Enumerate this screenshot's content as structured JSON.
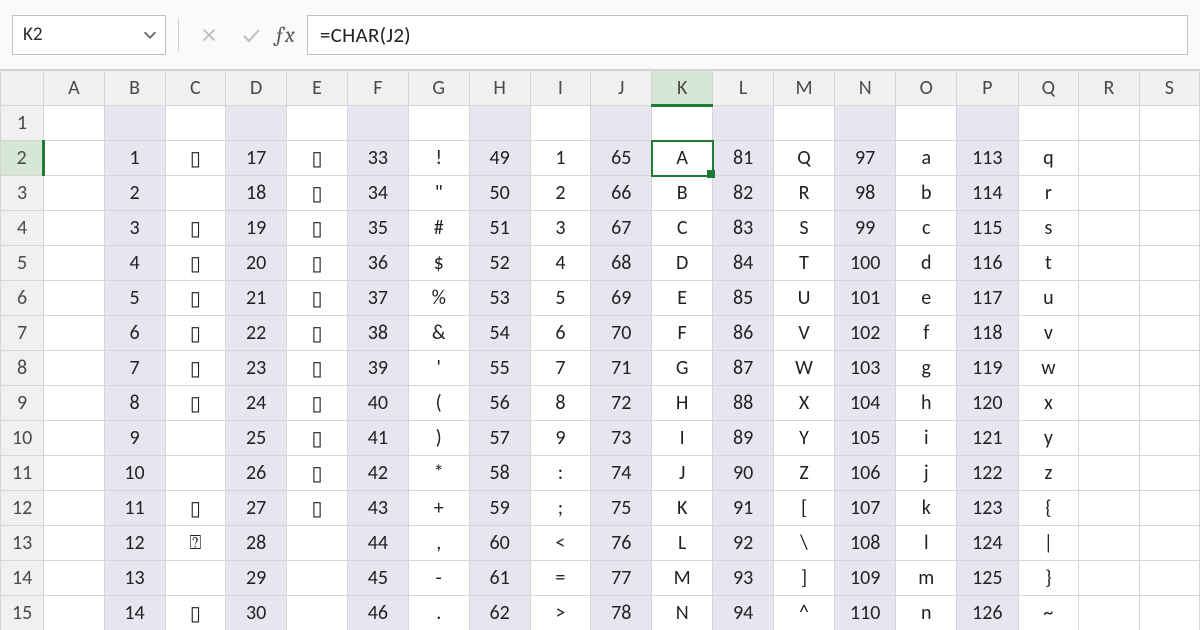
{
  "namebox": {
    "value": "K2"
  },
  "formula": {
    "text": "=CHAR(J2)"
  },
  "columns": [
    "A",
    "B",
    "C",
    "D",
    "E",
    "F",
    "G",
    "H",
    "I",
    "J",
    "K",
    "L",
    "M",
    "N",
    "O",
    "P",
    "Q",
    "R",
    "S"
  ],
  "row_numbers": [
    1,
    2,
    3,
    4,
    5,
    6,
    7,
    8,
    9,
    10,
    11,
    12,
    13,
    14,
    15
  ],
  "shaded_cols": [
    "B",
    "D",
    "F",
    "H",
    "J",
    "L",
    "N",
    "P"
  ],
  "active": {
    "col": "K",
    "row": 2
  },
  "rows": [
    {},
    {
      "B": "1",
      "C": "▯",
      "D": "17",
      "E": "▯",
      "F": "33",
      "G": "!",
      "H": "49",
      "I": "1",
      "J": "65",
      "K": "A",
      "L": "81",
      "M": "Q",
      "N": "97",
      "O": "a",
      "P": "113",
      "Q": "q"
    },
    {
      "B": "2",
      "C": "",
      "D": "18",
      "E": "▯",
      "F": "34",
      "G": "\"",
      "H": "50",
      "I": "2",
      "J": "66",
      "K": "B",
      "L": "82",
      "M": "R",
      "N": "98",
      "O": "b",
      "P": "114",
      "Q": "r"
    },
    {
      "B": "3",
      "C": "▯",
      "D": "19",
      "E": "▯",
      "F": "35",
      "G": "#",
      "H": "51",
      "I": "3",
      "J": "67",
      "K": "C",
      "L": "83",
      "M": "S",
      "N": "99",
      "O": "c",
      "P": "115",
      "Q": "s"
    },
    {
      "B": "4",
      "C": "▯",
      "D": "20",
      "E": "▯",
      "F": "36",
      "G": "$",
      "H": "52",
      "I": "4",
      "J": "68",
      "K": "D",
      "L": "84",
      "M": "T",
      "N": "100",
      "O": "d",
      "P": "116",
      "Q": "t"
    },
    {
      "B": "5",
      "C": "▯",
      "D": "21",
      "E": "▯",
      "F": "37",
      "G": "%",
      "H": "53",
      "I": "5",
      "J": "69",
      "K": "E",
      "L": "85",
      "M": "U",
      "N": "101",
      "O": "e",
      "P": "117",
      "Q": "u"
    },
    {
      "B": "6",
      "C": "▯",
      "D": "22",
      "E": "▯",
      "F": "38",
      "G": "&",
      "H": "54",
      "I": "6",
      "J": "70",
      "K": "F",
      "L": "86",
      "M": "V",
      "N": "102",
      "O": "f",
      "P": "118",
      "Q": "v"
    },
    {
      "B": "7",
      "C": "▯",
      "D": "23",
      "E": "▯",
      "F": "39",
      "G": "'",
      "H": "55",
      "I": "7",
      "J": "71",
      "K": "G",
      "L": "87",
      "M": "W",
      "N": "103",
      "O": "g",
      "P": "119",
      "Q": "w"
    },
    {
      "B": "8",
      "C": "▯",
      "D": "24",
      "E": "▯",
      "F": "40",
      "G": "(",
      "H": "56",
      "I": "8",
      "J": "72",
      "K": "H",
      "L": "88",
      "M": "X",
      "N": "104",
      "O": "h",
      "P": "120",
      "Q": "x"
    },
    {
      "B": "9",
      "C": "",
      "D": "25",
      "E": "▯",
      "F": "41",
      "G": ")",
      "H": "57",
      "I": "9",
      "J": "73",
      "K": "I",
      "L": "89",
      "M": "Y",
      "N": "105",
      "O": "i",
      "P": "121",
      "Q": "y"
    },
    {
      "B": "10",
      "C": "",
      "D": "26",
      "E": "▯",
      "F": "42",
      "G": "*",
      "H": "58",
      "I": ":",
      "J": "74",
      "K": "J",
      "L": "90",
      "M": "Z",
      "N": "106",
      "O": "j",
      "P": "122",
      "Q": "z"
    },
    {
      "B": "11",
      "C": "▯",
      "D": "27",
      "E": "▯",
      "F": "43",
      "G": "+",
      "H": "59",
      "I": ";",
      "J": "75",
      "K": "K",
      "L": "91",
      "M": "[",
      "N": "107",
      "O": "k",
      "P": "123",
      "Q": "{"
    },
    {
      "B": "12",
      "C": "⍰",
      "D": "28",
      "E": "",
      "F": "44",
      "G": ",",
      "H": "60",
      "I": "<",
      "J": "76",
      "K": "L",
      "L": "92",
      "M": "\\",
      "N": "108",
      "O": "l",
      "P": "124",
      "Q": "|"
    },
    {
      "B": "13",
      "C": "",
      "D": "29",
      "E": "",
      "F": "45",
      "G": "-",
      "H": "61",
      "I": "=",
      "J": "77",
      "K": "M",
      "L": "93",
      "M": "]",
      "N": "109",
      "O": "m",
      "P": "125",
      "Q": "}"
    },
    {
      "B": "14",
      "C": "▯",
      "D": "30",
      "E": "",
      "F": "46",
      "G": ".",
      "H": "62",
      "I": ">",
      "J": "78",
      "K": "N",
      "L": "94",
      "M": "^",
      "N": "110",
      "O": "n",
      "P": "126",
      "Q": "~"
    }
  ]
}
